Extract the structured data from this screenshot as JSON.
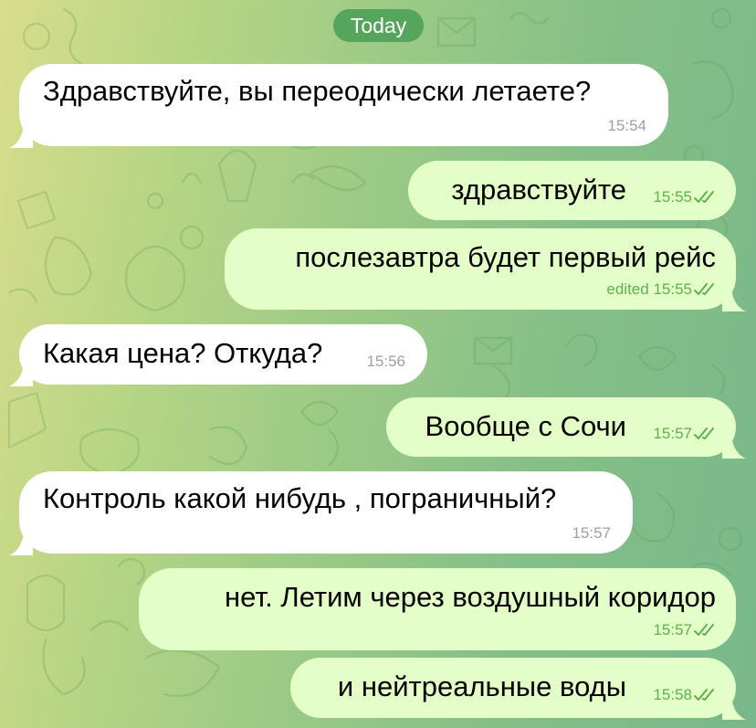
{
  "date_separator": "Today",
  "colors": {
    "incoming_bubble": "#ffffff",
    "outgoing_bubble": "#e3fec7",
    "read_checks": "#5fb04f",
    "date_chip": "#56a55c"
  },
  "messages": [
    {
      "direction": "incoming",
      "text": "Здравствуйте, вы переодически летаете?",
      "time": "15:54",
      "edited": ""
    },
    {
      "direction": "outgoing",
      "text": "здравствуйте",
      "time": "15:55",
      "edited": "",
      "status_icon": "double-check-icon"
    },
    {
      "direction": "outgoing",
      "text": "послезавтра будет первый рейс",
      "time": "15:55",
      "edited": "edited",
      "status_icon": "double-check-icon"
    },
    {
      "direction": "incoming",
      "text": "Какая цена? Откуда?",
      "time": "15:56",
      "edited": ""
    },
    {
      "direction": "outgoing",
      "text": "Вообще с Сочи",
      "time": "15:57",
      "edited": "",
      "status_icon": "double-check-icon"
    },
    {
      "direction": "incoming",
      "text": "Контроль какой нибудь , пограничный?",
      "time": "15:57",
      "edited": ""
    },
    {
      "direction": "outgoing",
      "text": "нет. Летим через воздушный коридор",
      "time": "15:57",
      "edited": "",
      "status_icon": "double-check-icon"
    },
    {
      "direction": "outgoing",
      "text": "и нейтреальные воды",
      "time": "15:58",
      "edited": "",
      "status_icon": "double-check-icon"
    }
  ]
}
